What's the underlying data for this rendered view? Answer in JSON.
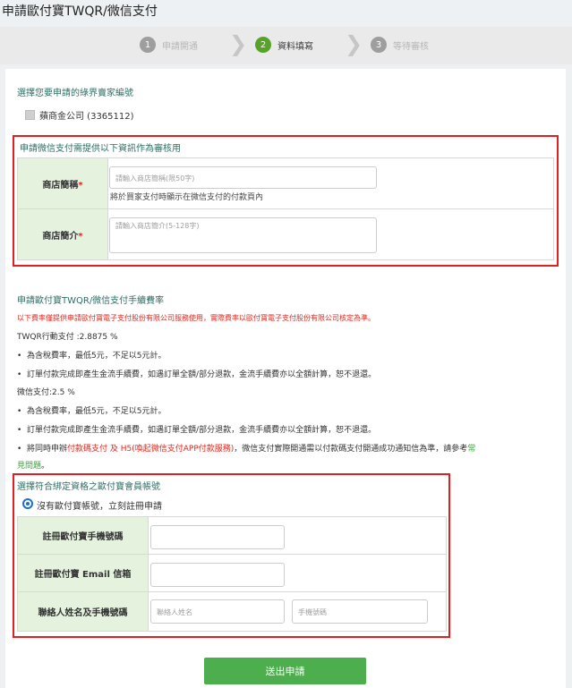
{
  "window": {
    "title": "申請歐付寶TWQR/微信支付"
  },
  "steps": [
    {
      "num": "1",
      "label": "申請開通"
    },
    {
      "num": "2",
      "label": "資料填寫"
    },
    {
      "num": "3",
      "label": "等待審核"
    }
  ],
  "account_section": {
    "title": "選擇您要申請的綠界賣家編號",
    "account_label": "蘋商金公司 (3365112)"
  },
  "wechat_section": {
    "title": "申請微信支付需提供以下資訊作為審核用",
    "store_name_label": "商店簡稱",
    "store_name_placeholder": "請輸入商店簡稱(限50字)",
    "store_name_hint": "將於買家支付時顯示在微信支付的付款頁內",
    "store_intro_label": "商店簡介",
    "store_intro_placeholder": "請輸入商店簡介(5-128字)",
    "required_mark": "*"
  },
  "fee_section": {
    "title": "申請歐付寶TWQR/微信支付手續費率",
    "note": "以下費率僅提供申請歐付寶電子支付股份有限公司服務使用，實際費率以歐付寶電子支付股份有限公司核定為準。",
    "twqr_rate": "TWQR行動支付 :2.8875 %",
    "twqr_bullets": [
      "為含稅費率，最低5元，不足以5元計。",
      "訂單付款完成即產生金流手續費，如遇訂單全額/部分退款，金流手續費亦以全額計算，恕不退還。"
    ],
    "wechat_rate": "微信支付:2.5 %",
    "wechat_bullets": [
      "為含稅費率，最低5元，不足以5元計。",
      "訂單付款完成即產生金流手續費，如遇訂單全額/部分退款，金流手續費亦以全額計算，恕不退還。"
    ],
    "bullet3_pre": "將同時申辦",
    "bullet3_red": "付款碼支付 及 H5(喚起微信支付APP付款服務)",
    "bullet3_mid": "，微信支付實際開通需以付款碼支付開通成功通知信為準，請參考",
    "bullet3_link": "常",
    "bullet3_line2_link": "見問題",
    "bullet3_end": "。"
  },
  "member_section": {
    "title": "選擇符合綁定資格之歐付寶會員帳號",
    "radio_label": "沒有歐付寶帳號，立刻註冊申請",
    "phone_label": "註冊歐付寶手機號碼",
    "email_label": "註冊歐付寶 Email 信箱",
    "contact_label": "聯絡人姓名及手機號碼",
    "contact_name_placeholder": "聯絡人姓名",
    "contact_phone_placeholder": "手機號碼"
  },
  "submit": {
    "label": "送出申請"
  }
}
